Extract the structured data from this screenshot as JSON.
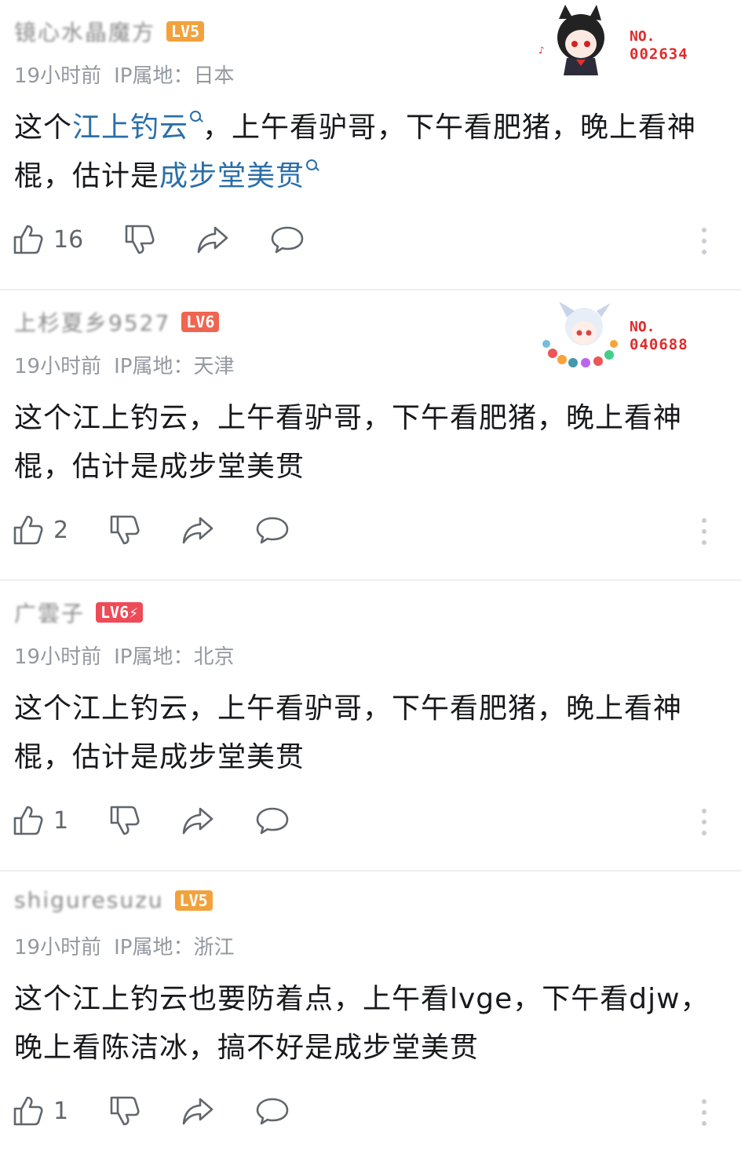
{
  "comments": [
    {
      "username": "镜心水晶魔方",
      "level": "LV5",
      "level_color": "#f2a23c",
      "time": "19小时前",
      "ip": "IP属地：日本",
      "content_parts": [
        {
          "text": "这个",
          "link": false
        },
        {
          "text": "江上钓云",
          "link": true
        },
        {
          "text": "，上午看驴哥，下午看肥猪，晚上看神棍，估计是",
          "link": false
        },
        {
          "text": "成步堂美贯",
          "link": true
        }
      ],
      "likes": "16",
      "badge": {
        "no_label": "NO.",
        "number": "002634",
        "avatar_icon": "cat-girl-avatar-icon"
      }
    },
    {
      "username": "上杉夏乡9527",
      "level": "LV6",
      "level_color": "#f0654f",
      "time": "19小时前",
      "ip": "IP属地：天津",
      "content_parts": [
        {
          "text": "这个江上钓云，上午看驴哥，下午看肥猪，晚上看神棍，估计是成步堂美贯",
          "link": false
        }
      ],
      "likes": "2",
      "badge": {
        "no_label": "NO.",
        "number": "040688",
        "avatar_icon": "flower-girl-avatar-icon"
      }
    },
    {
      "username": "广雲子",
      "level": "LV6⚡",
      "level_color": "#ee4b58",
      "time": "19小时前",
      "ip": "IP属地：北京",
      "content_parts": [
        {
          "text": "这个江上钓云，上午看驴哥，下午看肥猪，晚上看神棍，估计是成步堂美贯",
          "link": false
        }
      ],
      "likes": "1",
      "badge": null
    },
    {
      "username": "shiguresuzu",
      "level": "LV5",
      "level_color": "#f2a23c",
      "time": "19小时前",
      "ip": "IP属地：浙江",
      "content_parts": [
        {
          "text": "这个江上钓云也要防着点，上午看lvge，下午看djw，晚上看陈洁冰，搞不好是成步堂美贯",
          "link": false
        }
      ],
      "likes": "1",
      "badge": null
    }
  ],
  "icons": {
    "like": "thumbs-up-icon",
    "dislike": "thumbs-down-icon",
    "share": "share-arrow-icon",
    "reply": "comment-bubble-icon",
    "more": "more-vertical-icon"
  },
  "colors": {
    "link": "#2a6fa8",
    "meta": "#9499a0",
    "badge_number": "#e02b2b"
  }
}
